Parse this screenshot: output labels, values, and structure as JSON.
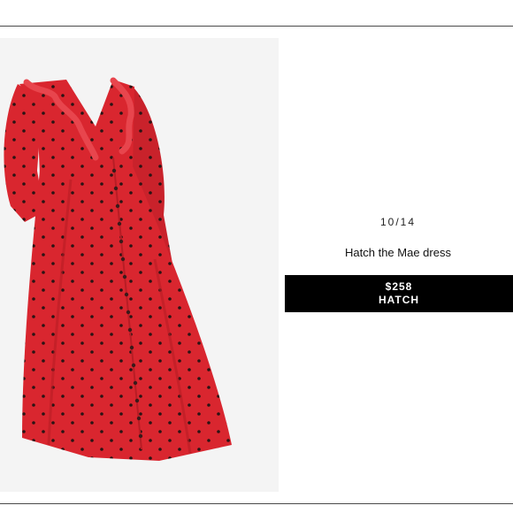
{
  "slide": {
    "counter": "10/14",
    "title": "Hatch the Mae dress",
    "price": "$258",
    "brand": "HATCH"
  },
  "image": {
    "subject": "red-polka-dot-ruffle-dress",
    "colors": {
      "dress": "#d9262f",
      "dress_shadow": "#b81d25",
      "dots": "#2a1414",
      "background": "#f4f4f4"
    }
  }
}
